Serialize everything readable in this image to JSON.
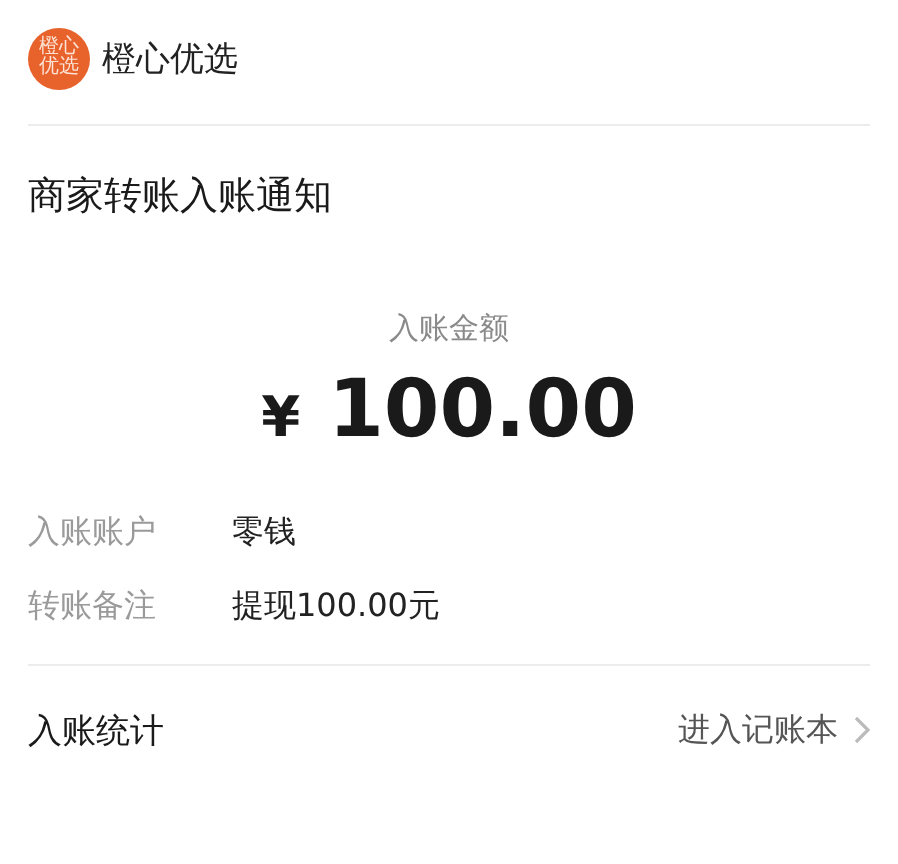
{
  "account": {
    "logo_text": "橙心优选",
    "name": "橙心优选"
  },
  "title": "商家转账入账通知",
  "amount": {
    "label": "入账金额",
    "currency": "¥",
    "value": "100.00"
  },
  "details": [
    {
      "label": "入账账户",
      "value": "零钱"
    },
    {
      "label": "转账备注",
      "value": "提现100.00元"
    }
  ],
  "footer": {
    "label": "入账统计",
    "link": "进入记账本"
  }
}
